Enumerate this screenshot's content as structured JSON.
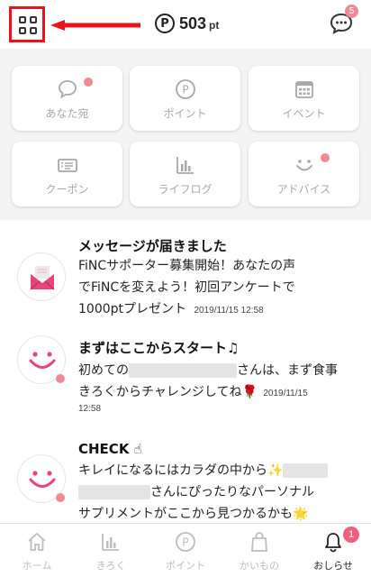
{
  "header": {
    "points_value": "503",
    "points_unit": "pt",
    "points_icon_glyph": "P",
    "chat_badge_count": "5",
    "accent_red": "#e8131b",
    "badge_pink": "#f08a94"
  },
  "tiles": [
    {
      "label": "あなた宛",
      "icon": "speech-bubble-icon",
      "has_dot": true
    },
    {
      "label": "ポイント",
      "icon": "point-coin-icon",
      "has_dot": false
    },
    {
      "label": "イベント",
      "icon": "calendar-icon",
      "has_dot": false
    },
    {
      "label": "クーポン",
      "icon": "coupon-ticket-icon",
      "has_dot": false
    },
    {
      "label": "ライフログ",
      "icon": "bar-chart-icon",
      "has_dot": false
    },
    {
      "label": "アドバイス",
      "icon": "smiley-icon",
      "has_dot": true
    }
  ],
  "notifications": [
    {
      "title": "メッセージが届きました",
      "body_line1": "FiNCサポーター募集開始！あなたの声",
      "body_line2": "でFiNCを変えよう！初回アンケートで",
      "body_line3": "1000ptプレゼント",
      "time": "2019/11/15 12:58",
      "icon": "envelope-icon"
    },
    {
      "title": "まずはここからスタート♫",
      "body_line1_pre": "初めての",
      "body_line1_post": "さんは、まず食事",
      "body_line2": "きろくからチャレンジしてね🌹",
      "time_part1": "2019/11/15",
      "time_part2": "12:58",
      "icon": "smiley-icon"
    },
    {
      "title": "CHECK ☝",
      "body_line1": "キレイになるにはカラダの中から✨",
      "body_line2_post": "さんにぴったりなパーソナル",
      "body_line3": "サプリメントがここから見つかるかも🌟",
      "icon": "smiley-icon"
    }
  ],
  "bottom_nav": {
    "items": [
      {
        "label": "ホーム",
        "icon": "home-icon"
      },
      {
        "label": "きろく",
        "icon": "record-chart-icon"
      },
      {
        "label": "ポイント",
        "icon": "point-icon"
      },
      {
        "label": "かいもの",
        "icon": "shopping-bag-icon"
      },
      {
        "label": "おしらせ",
        "icon": "bell-icon"
      }
    ],
    "active": "おしらせ",
    "bell_badge_count": "1"
  }
}
